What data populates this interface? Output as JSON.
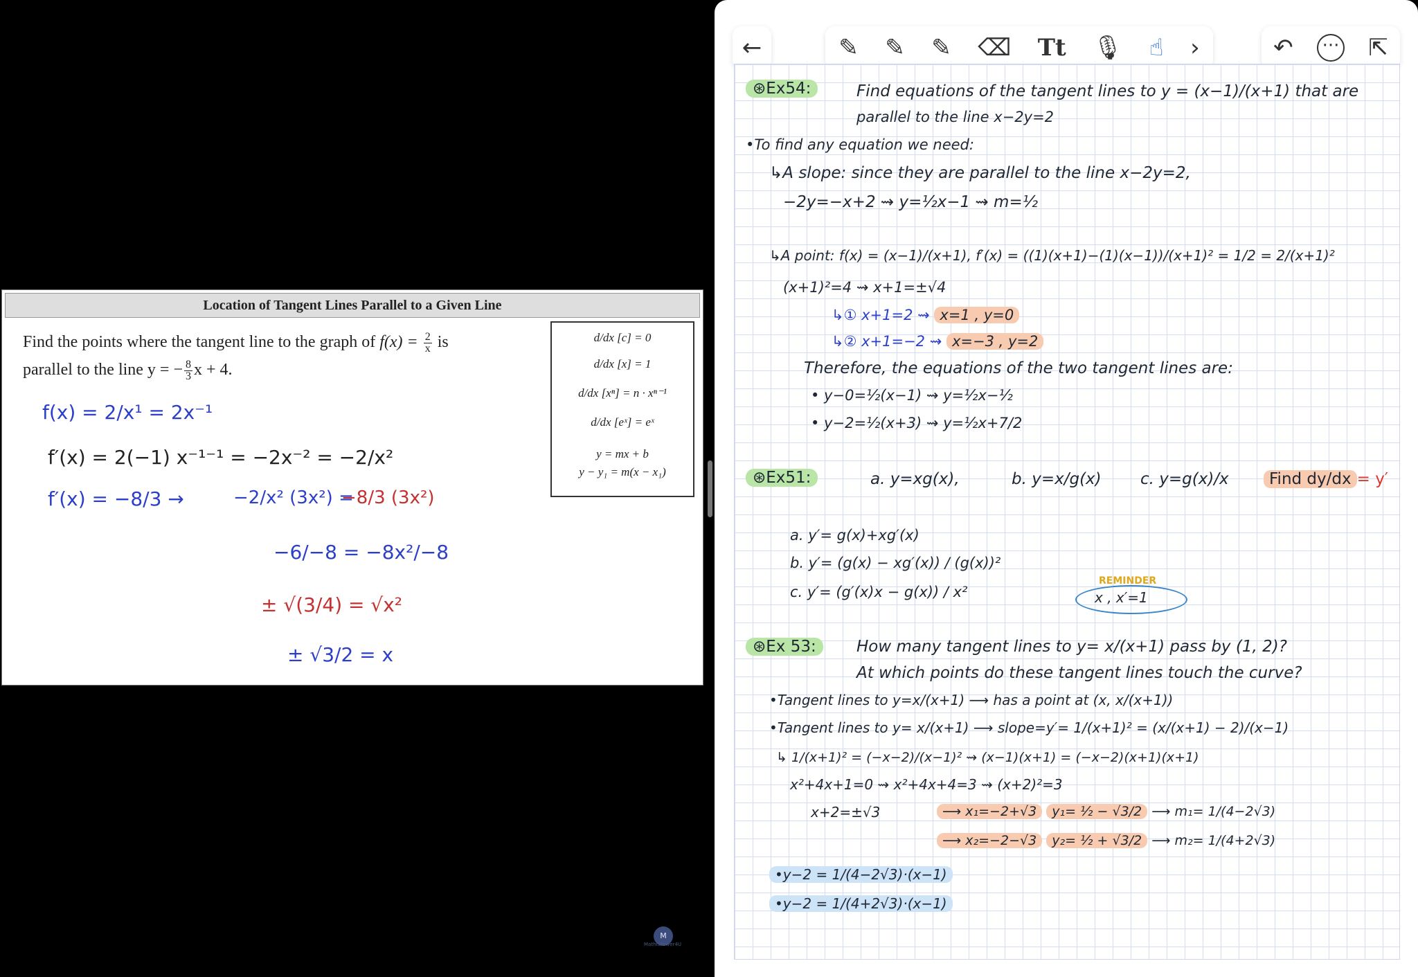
{
  "left": {
    "slide_title": "Location of Tangent Lines Parallel to a Given Line",
    "question": {
      "line1_pre": "Find the points where the tangent line to the graph of ",
      "fx": "f(x) =",
      "frac_num": "2",
      "frac_den": "x",
      "line1_post": " is",
      "line2_pre": "parallel to the line y = −",
      "slope_num": "8",
      "slope_den": "3",
      "line2_post": "x + 4."
    },
    "formulas": [
      "d/dx [c] = 0",
      "d/dx [x] = 1",
      "d/dx [xⁿ] = n · xⁿ⁻¹",
      "d/dx [eˣ] = eˣ",
      "y = mx + b",
      "y − y₁ = m(x − x₁)"
    ],
    "handwriting": {
      "l1": "f(x) = 2/x¹ = 2x⁻¹",
      "l2": "f′(x) = 2(−1) x⁻¹⁻¹  = −2x⁻²  =  −2/x²",
      "l3": "f′(x) = −8/3  →",
      "l3b": "−2/x² (3x²) =",
      "l3c": "−8/3 (3x²)",
      "l4": "−6/−8  =  −8x²/−8",
      "l5": "± √(3/4)   = √x²",
      "l6": "± √3/2  = x"
    },
    "watermark": "MathIsPower4U"
  },
  "toolbar": {
    "back_icon": "←",
    "tools": [
      "✎",
      "✎",
      "✎",
      "⌫",
      "Tt",
      "🎙",
      "☝",
      "›"
    ],
    "undo_icon": "↶",
    "more_icon": "···",
    "share_icon": "⇱"
  },
  "notes": {
    "ex54_label": "⊛Ex54:",
    "ex54_q1": "Find equations of the tangent lines to y = (x−1)/(x+1)  that are",
    "ex54_q2": "parallel to the line  x−2y=2",
    "need": "•To find any equation we need:",
    "slope_line": "↳A slope: since they are parallel to the line x−2y=2,",
    "slope_calc": "−2y=−x+2 ⇝ y=½x−1 ⇝ m=½",
    "point_line": "↳A point:   f(x) = (x−1)/(x+1),  f′(x) = ((1)(x+1)−(1)(x−1))/(x+1)²  =  1/2 = 2/(x+1)²",
    "point_calc": "(x+1)²=4 ⇝ x+1=±√4",
    "case1": "↳① x+1=2 ⇝",
    "case1_res": "x=1  ,  y=0",
    "case2": "↳② x+1=−2 ⇝",
    "case2_res": "x=−3  ,  y=2",
    "therefore": "Therefore, the equations of the two tangent lines are:",
    "eq1": "• y−0=½(x−1) ⇝ y=½x−½",
    "eq2": "• y−2=½(x+3) ⇝ y=½x+7/2",
    "ex51_label": "⊛Ex51:",
    "ex51_a": "a. y=xg(x),",
    "ex51_b": "b. y=x/g(x)",
    "ex51_c": "c. y=g(x)/x",
    "ex51_find": "Find dy/dx",
    "ex51_y": "= y′",
    "reminder": "REMINDER",
    "reminder_body": "x , x′=1",
    "ans_a": "a. y′=  g(x)+xg′(x)",
    "ans_b": "b. y′=  (g(x) − xg′(x)) / (g(x))²",
    "ans_c": "c. y′=  (g′(x)x − g(x)) / x²",
    "ex53_label": "⊛Ex 53:",
    "ex53_q1": "How many tangent lines to y= x/(x+1)   pass by (1, 2)?",
    "ex53_q2": "At which points do these tangent lines touch the curve?",
    "t1": "•Tangent lines to y=x/(x+1) ⟶ has a point at (x, x/(x+1))",
    "t2": "•Tangent lines to y= x/(x+1) ⟶ slope=y′= 1/(x+1)² = (x/(x+1) − 2)/(x−1)",
    "t3": "↳ 1/(x+1)² = (−x−2)/(x−1)² ⇝ (x−1)(x+1) = (−x−2)(x+1)(x+1)",
    "t4": "x²+4x+1=0 ⇝ x²+4x+4=3 ⇝ (x+2)²=3",
    "t5": "x+2=±√3",
    "r1": "⟶ x₁=−2+√3",
    "r1y": "y₁= ½ − √3/2",
    "r1m": "⟶ m₁= 1/(4−2√3)",
    "r2": "⟶ x₂=−2−√3",
    "r2y": "y₂= ½ + √3/2",
    "r2m": "⟶ m₂= 1/(4+2√3)",
    "f1": "•y−2 = 1/(4−2√3)·(x−1)",
    "f2": "•y−2 = 1/(4+2√3)·(x−1)"
  }
}
